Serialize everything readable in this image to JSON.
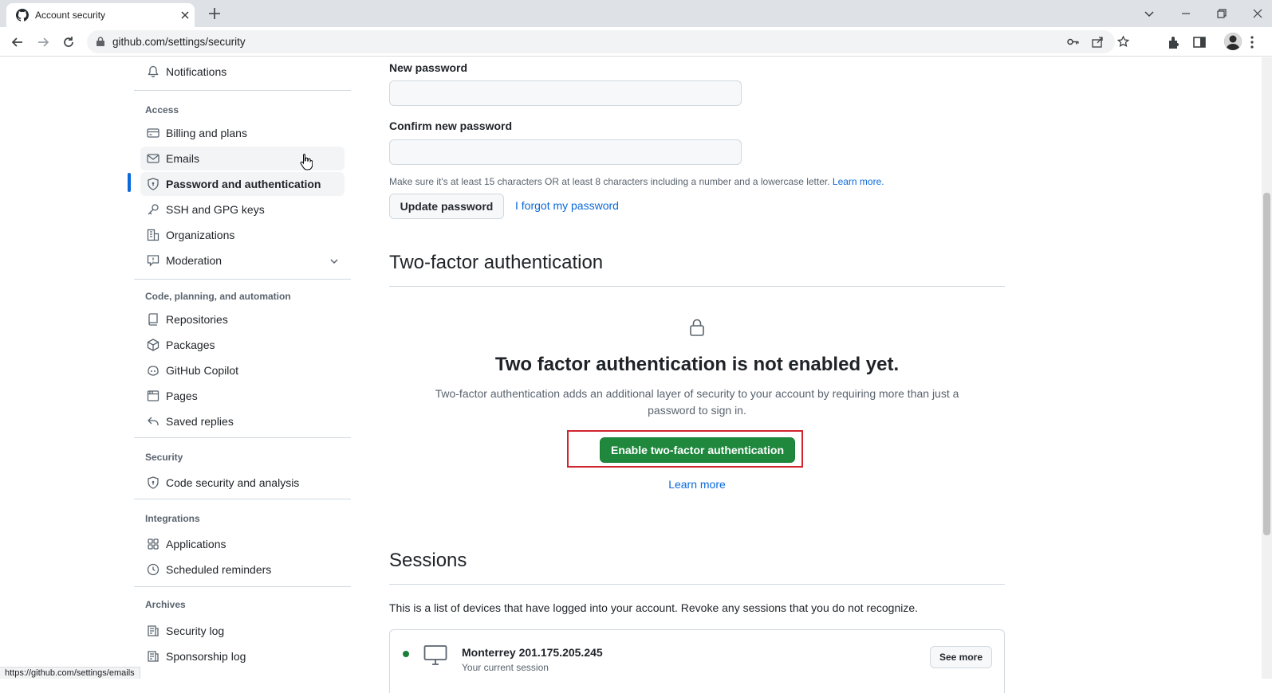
{
  "browser": {
    "tab_title": "Account security",
    "url": "github.com/settings/security",
    "status_url": "https://github.com/settings/emails"
  },
  "sidebar": {
    "top_item": {
      "label": "Notifications",
      "icon": "bell-icon"
    },
    "access_heading": "Access",
    "access_items": [
      {
        "label": "Billing and plans",
        "icon": "credit-card-icon"
      },
      {
        "label": "Emails",
        "icon": "mail-icon"
      },
      {
        "label": "Password and authentication",
        "icon": "shield-lock-icon",
        "active": true
      },
      {
        "label": "SSH and GPG keys",
        "icon": "key-icon"
      },
      {
        "label": "Organizations",
        "icon": "organization-icon"
      },
      {
        "label": "Moderation",
        "icon": "report-icon"
      }
    ],
    "code_heading": "Code, planning, and automation",
    "code_items": [
      {
        "label": "Repositories",
        "icon": "repo-icon"
      },
      {
        "label": "Packages",
        "icon": "package-icon"
      },
      {
        "label": "GitHub Copilot",
        "icon": "copilot-icon"
      },
      {
        "label": "Pages",
        "icon": "browser-icon"
      },
      {
        "label": "Saved replies",
        "icon": "reply-icon"
      }
    ],
    "security_heading": "Security",
    "security_items": [
      {
        "label": "Code security and analysis",
        "icon": "shield-lock-icon"
      }
    ],
    "integrations_heading": "Integrations",
    "integrations_items": [
      {
        "label": "Applications",
        "icon": "apps-icon"
      },
      {
        "label": "Scheduled reminders",
        "icon": "clock-icon"
      }
    ],
    "archives_heading": "Archives",
    "archives_items": [
      {
        "label": "Security log",
        "icon": "log-icon"
      },
      {
        "label": "Sponsorship log",
        "icon": "log-icon"
      }
    ]
  },
  "password": {
    "new_label": "New password",
    "confirm_label": "Confirm new password",
    "hint": "Make sure it's at least 15 characters OR at least 8 characters including a number and a lowercase letter.",
    "hint_link": "Learn more.",
    "update_button": "Update password",
    "forgot_link": "I forgot my password"
  },
  "two_factor": {
    "heading": "Two-factor authentication",
    "blank_title": "Two factor authentication is not enabled yet.",
    "blank_desc": "Two-factor authentication adds an additional layer of security to your account by requiring more than just a password to sign in.",
    "enable_button": "Enable two-factor authentication",
    "learn_more": "Learn more"
  },
  "sessions": {
    "heading": "Sessions",
    "description": "This is a list of devices that have logged into your account. Revoke any sessions that you do not recognize.",
    "current": {
      "name": "Monterrey 201.175.205.245",
      "sub": "Your current session",
      "button": "See more"
    }
  },
  "colors": {
    "accent": "#0969da",
    "primary_button": "#1f883d",
    "highlight": "#d1242f"
  }
}
